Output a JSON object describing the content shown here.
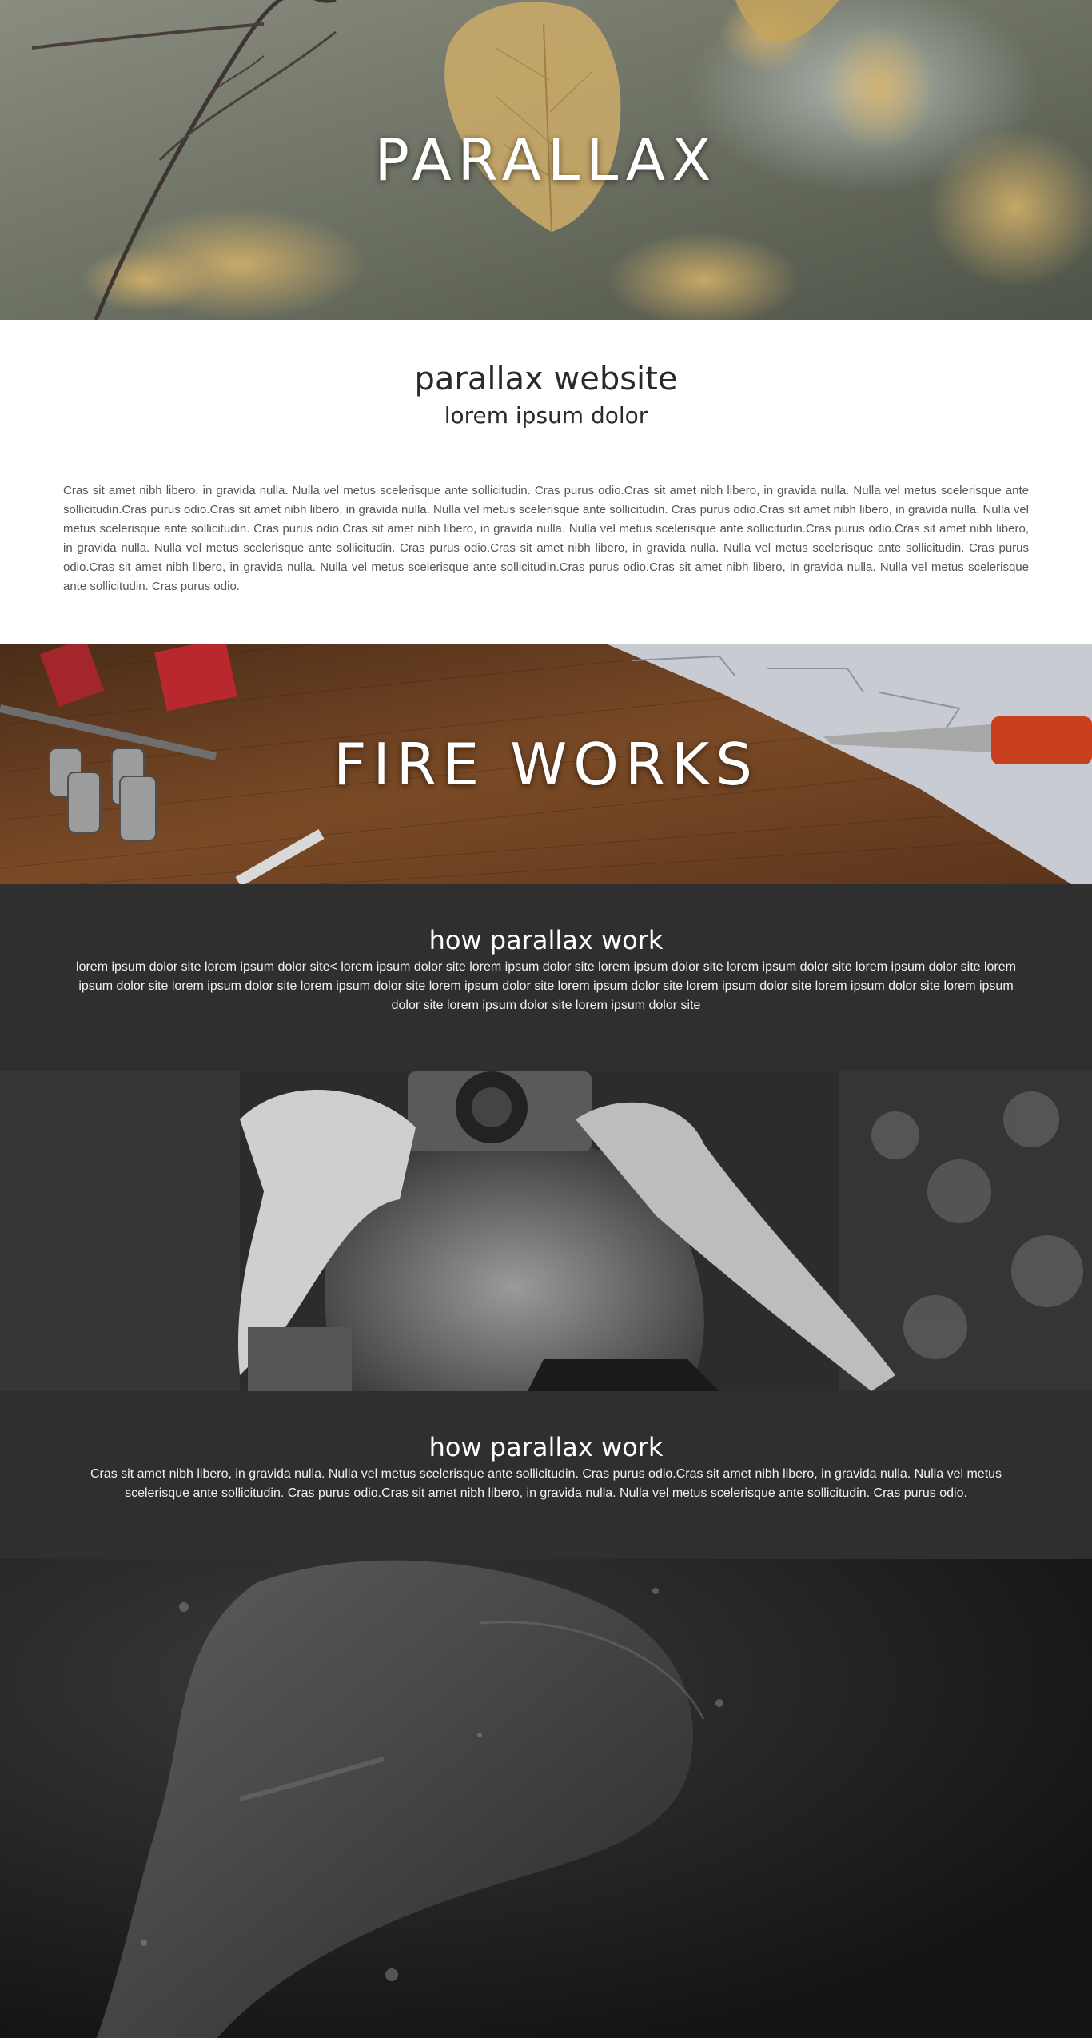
{
  "hero_1": {
    "title": "PARALLAX"
  },
  "intro": {
    "heading": "parallax website",
    "subheading": "lorem ipsum dolor",
    "body": "Cras sit amet nibh libero, in gravida nulla. Nulla vel metus scelerisque ante sollicitudin. Cras purus odio.Cras sit amet nibh libero, in gravida nulla. Nulla vel metus scelerisque ante sollicitudin.Cras purus odio.Cras sit amet nibh libero, in gravida nulla. Nulla vel metus scelerisque ante sollicitudin. Cras purus odio.Cras sit amet nibh libero, in gravida nulla. Nulla vel metus scelerisque ante sollicitudin. Cras purus odio.Cras sit amet nibh libero, in gravida nulla. Nulla vel metus scelerisque ante sollicitudin.Cras purus odio.Cras sit amet nibh libero, in gravida nulla. Nulla vel metus scelerisque ante sollicitudin. Cras purus odio.Cras sit amet nibh libero, in gravida nulla. Nulla vel metus scelerisque ante sollicitudin. Cras purus odio.Cras sit amet nibh libero, in gravida nulla. Nulla vel metus scelerisque ante sollicitudin.Cras purus odio.Cras sit amet nibh libero, in gravida nulla. Nulla vel metus scelerisque ante sollicitudin. Cras purus odio."
  },
  "hero_2": {
    "title": "FIRE WORKS"
  },
  "section_1": {
    "heading": "how parallax work",
    "body": "lorem ipsum dolor site lorem ipsum dolor site< lorem ipsum dolor site lorem ipsum dolor site lorem ipsum dolor site lorem ipsum dolor site lorem ipsum dolor site lorem ipsum dolor site lorem ipsum dolor site lorem ipsum dolor site lorem ipsum dolor site lorem ipsum dolor site lorem ipsum dolor site lorem ipsum dolor site lorem ipsum dolor site lorem ipsum dolor site lorem ipsum dolor site"
  },
  "section_2": {
    "heading": "how parallax work",
    "body": "Cras sit amet nibh libero, in gravida nulla. Nulla vel metus scelerisque ante sollicitudin. Cras purus odio.Cras sit amet nibh libero, in gravida nulla. Nulla vel metus scelerisque ante sollicitudin. Cras purus odio.Cras sit amet nibh libero, in gravida nulla. Nulla vel metus scelerisque ante sollicitudin. Cras purus odio."
  },
  "colors": {
    "dark_section_bg": "#2f2f2f",
    "body_text": "#555555",
    "heading_text": "#2a2a2a"
  }
}
